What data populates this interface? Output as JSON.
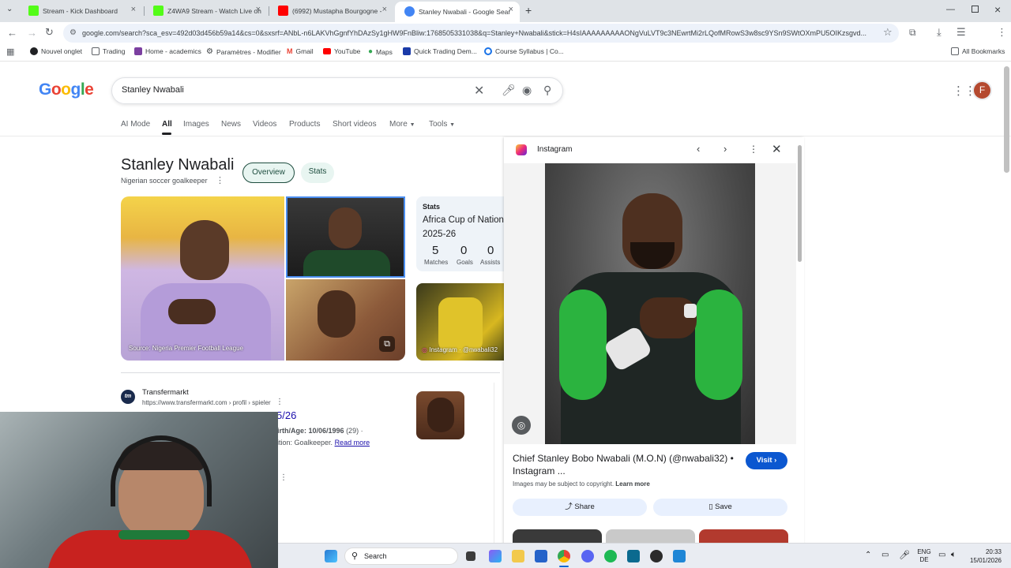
{
  "tabs": [
    {
      "label": "Stream - Kick Dashboard",
      "color": "#53fc18"
    },
    {
      "label": "Z4WA9 Stream - Watch Live on",
      "color": "#53fc18"
    },
    {
      "label": "(6992) Mustapha Bourgogne -",
      "color": "#ff0000"
    },
    {
      "label": "Stanley Nwabali - Google Sear",
      "color": "#4285f4"
    }
  ],
  "url": "google.com/search?sca_esv=492d03d456b59a14&cs=0&sxsrf=ANbL-n6LAKVhGgnfYhDAzSy1gHW9FnBliw:1768505331038&q=Stanley+Nwabali&stick=H4sIAAAAAAAAAONgVuLVT9c3NEwrtMi2rLQofMRowS3w8sc9YSn9SWtOXmPU5OIKzsgvd...",
  "bookmarks": [
    {
      "label": "Nouvel onglet",
      "icon": "globe-icon",
      "color": "#202124"
    },
    {
      "label": "Trading",
      "icon": "folder-icon",
      "color": "#5f6368"
    },
    {
      "label": "Home - academics",
      "icon": "academics-icon",
      "color": "#7b3fa0"
    },
    {
      "label": "Paramètres - Modifier",
      "icon": "gear-icon",
      "color": "#3c4043"
    },
    {
      "label": "Gmail",
      "icon": "gmail-icon",
      "color": "#ea4335"
    },
    {
      "label": "YouTube",
      "icon": "youtube-icon",
      "color": "#ff0000"
    },
    {
      "label": "Maps",
      "icon": "maps-icon",
      "color": "#34a853"
    },
    {
      "label": "Quick Trading Dem...",
      "icon": "trading-icon",
      "color": "#1a3aa8"
    },
    {
      "label": "Course Syllabus | Co...",
      "icon": "course-icon",
      "color": "#1a73e8"
    }
  ],
  "all_bookmarks": "All Bookmarks",
  "google": {
    "logo": [
      "G",
      "o",
      "o",
      "g",
      "l",
      "e"
    ],
    "logo_colors": [
      "#4285f4",
      "#ea4335",
      "#fbbc05",
      "#4285f4",
      "#34a853",
      "#ea4335"
    ],
    "query": "Stanley Nwabali",
    "nav": [
      "AI Mode",
      "All",
      "Images",
      "News",
      "Videos",
      "Products",
      "Short videos",
      "More",
      "Tools"
    ],
    "avatar_letter": "F"
  },
  "entity": {
    "title": "Stanley Nwabali",
    "subtitle": "Nigerian soccer goalkeeper",
    "pills": [
      "Overview",
      "Stats"
    ],
    "image_source": "Source: Nigeria Premier Football League",
    "instagram_caption": "Instagram · @nwabali32",
    "stats": {
      "label": "Stats",
      "competition": "Africa Cup of Nations",
      "season": "2025-26",
      "items": [
        {
          "value": "5",
          "label": "Matches"
        },
        {
          "value": "0",
          "label": "Goals"
        },
        {
          "value": "0",
          "label": "Assists"
        }
      ]
    }
  },
  "result": {
    "site": "Transfermarkt",
    "site_icon": "tm",
    "url": "https://www.transfermarkt.com › profil › spieler",
    "title_fragment": "5/26",
    "snippet_1a": "irth/Age: 10/06/1996",
    "snippet_1b": "(29) ·",
    "snippet_2a": "ition: Goalkeeper.",
    "read_more": "Read more"
  },
  "panel": {
    "source": "Instagram",
    "title": "Chief Stanley Bobo Nwabali (M.O.N) (@nwabali32) • Instagram ...",
    "visit": "Visit",
    "copyright": "Images may be subject to copyright.",
    "learn_more": "Learn more",
    "share": "Share",
    "save": "Save"
  },
  "taskbar": {
    "search": "Search",
    "lang_top": "ENG",
    "lang_bottom": "DE",
    "time": "20:33",
    "date": "15/01/2026"
  }
}
